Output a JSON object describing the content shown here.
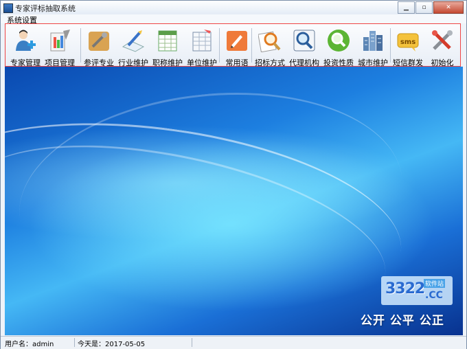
{
  "window": {
    "title": "专家评标抽取系统"
  },
  "menu": {
    "items": [
      "系统设置"
    ]
  },
  "toolbar": {
    "items": [
      {
        "label": "专家管理",
        "icon": "expert-user-icon"
      },
      {
        "label": "项目管理",
        "icon": "project-icon"
      },
      {
        "label": "参评专业",
        "icon": "specialty-tools-icon"
      },
      {
        "label": "行业维护",
        "icon": "industry-icon"
      },
      {
        "label": "职称维护",
        "icon": "title-sheet-icon"
      },
      {
        "label": "单位维护",
        "icon": "unit-sheet-icon"
      },
      {
        "label": "常用语",
        "icon": "phrase-icon"
      },
      {
        "label": "招标方式",
        "icon": "bid-search-icon"
      },
      {
        "label": "代理机构",
        "icon": "agency-search-icon"
      },
      {
        "label": "投资性质",
        "icon": "investment-search-icon"
      },
      {
        "label": "城市维护",
        "icon": "city-buildings-icon"
      },
      {
        "label": "短信群发",
        "icon": "sms-icon"
      },
      {
        "label": "初始化",
        "icon": "init-tools-icon"
      }
    ]
  },
  "watermark": {
    "brand": "3322",
    "sub": "软件站",
    "domain": ".CC"
  },
  "slogan": "公开 公平 公正",
  "status": {
    "user": "用户名：admin",
    "today": "今天是：2017-05-05"
  }
}
